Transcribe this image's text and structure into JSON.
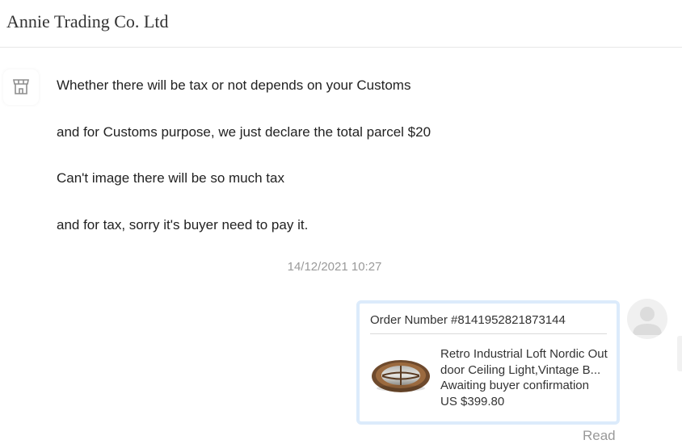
{
  "header": {
    "title": "Annie Trading Co. Ltd"
  },
  "messages": [
    "Whether there will be tax or not depends on your Customs",
    "and for Customs purpose, we just declare the total parcel $20",
    "Can't image there will be so much tax",
    "and for tax, sorry it's buyer need to pay it."
  ],
  "timestamp": "14/12/2021 10:27",
  "order_card": {
    "order_number": "Order Number #8141952821873144",
    "product_title": "Retro Industrial Loft Nordic Outdoor Ceiling Light,Vintage B...",
    "status": "Awaiting buyer confirmation",
    "price": "US $399.80"
  },
  "read_status": "Read",
  "icons": {
    "shop_avatar": "storefront-icon",
    "user_avatar": "user-avatar-icon",
    "product_image": "ceiling-light-image"
  }
}
